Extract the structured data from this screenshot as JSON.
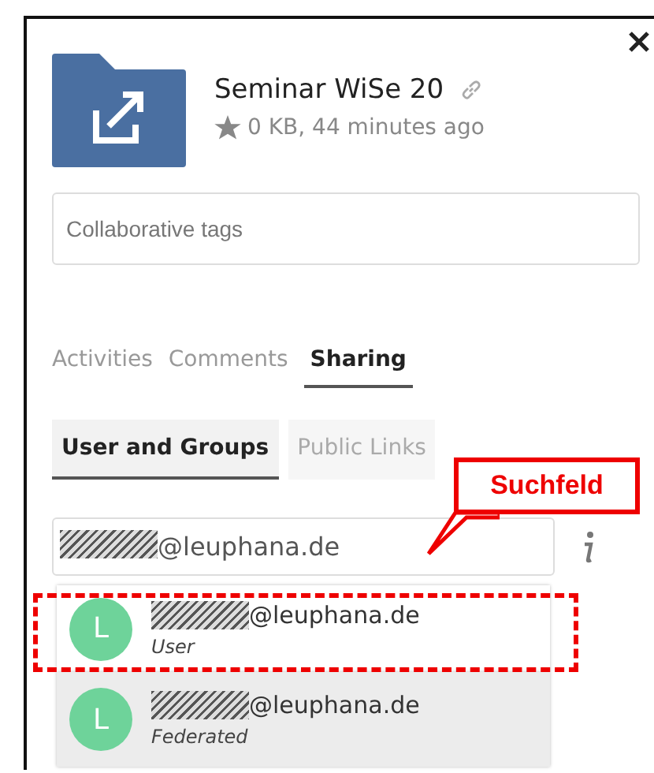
{
  "file": {
    "title": "Seminar WiSe 20",
    "meta": "0 KB, 44 minutes ago"
  },
  "tags_field": {
    "placeholder": "Collaborative tags"
  },
  "tabs": [
    {
      "label": "Activities",
      "selected": false
    },
    {
      "label": "Comments",
      "selected": false
    },
    {
      "label": "Sharing",
      "selected": true
    }
  ],
  "subtabs": [
    {
      "label": "User and Groups",
      "selected": true
    },
    {
      "label": "Public Links",
      "selected": false
    }
  ],
  "search": {
    "value": "@leuphana.de",
    "redacted": true
  },
  "suggestions": [
    {
      "avatar": "L",
      "name": "@leuphana.de",
      "redacted": true,
      "type": "User",
      "selected": false
    },
    {
      "avatar": "L",
      "name": "@leuphana.de",
      "redacted": true,
      "type": "Federated",
      "selected": true
    }
  ],
  "annotation": {
    "callout": "Suchfeld"
  }
}
